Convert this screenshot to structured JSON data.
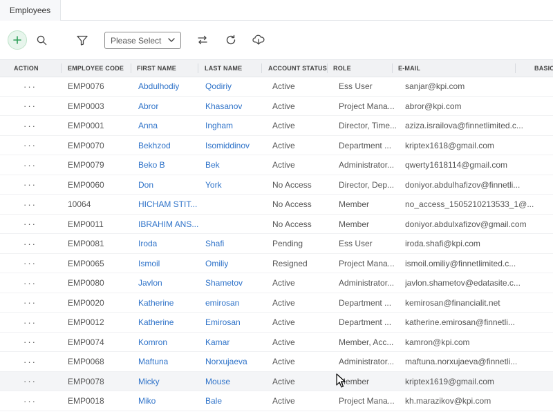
{
  "tab": {
    "label": "Employees"
  },
  "toolbar": {
    "select_placeholder": "Please Select"
  },
  "columns": [
    "ACTION",
    "EMPLOYEE CODE",
    "FIRST NAME",
    "LAST NAME",
    "ACCOUNT STATUS",
    "ROLE",
    "E-MAIL",
    "BASIC"
  ],
  "action_label": "···",
  "rows": [
    {
      "code": "EMP0076",
      "first": "Abdulhodiy",
      "last": "Qodiriy",
      "status": "Active",
      "role": "Ess User",
      "email": "sanjar@kpi.com"
    },
    {
      "code": "EMP0003",
      "first": "Abror",
      "last": "Khasanov",
      "status": "Active",
      "role": "Project Mana...",
      "email": "abror@kpi.com"
    },
    {
      "code": "EMP0001",
      "first": "Anna",
      "last": "Ingham",
      "status": "Active",
      "role": "Director, Time...",
      "email": "aziza.israilova@finnetlimited.c..."
    },
    {
      "code": "EMP0070",
      "first": "Bekhzod",
      "last": "Isomiddinov",
      "status": "Active",
      "role": "Department ...",
      "email": "kriptex1618@gmail.com"
    },
    {
      "code": "EMP0079",
      "first": "Beko B",
      "last": "Bek",
      "status": "Active",
      "role": "Administrator...",
      "email": "qwerty1618114@gmail.com"
    },
    {
      "code": "EMP0060",
      "first": "Don",
      "last": "York",
      "status": "No Access",
      "role": "Director, Dep...",
      "email": "doniyor.abdulhafizov@finnetli..."
    },
    {
      "code": "10064",
      "first": "HICHAM STIT...",
      "last": "",
      "status": "No Access",
      "role": "Member",
      "email": "no_access_1505210213533_1@..."
    },
    {
      "code": "EMP0011",
      "first": "IBRAHIM ANS...",
      "last": "",
      "status": "No Access",
      "role": "Member",
      "email": "doniyor.abdulxafizov@gmail.com"
    },
    {
      "code": "EMP0081",
      "first": "Iroda",
      "last": "Shafi",
      "status": "Pending",
      "role": "Ess User",
      "email": "iroda.shafi@kpi.com"
    },
    {
      "code": "EMP0065",
      "first": "Ismoil",
      "last": "Omiliy",
      "status": "Resigned",
      "role": "Project Mana...",
      "email": "ismoil.omiliy@finnetlimited.c..."
    },
    {
      "code": "EMP0080",
      "first": "Javlon",
      "last": "Shametov",
      "status": "Active",
      "role": "Administrator...",
      "email": "javlon.shametov@edatasite.c..."
    },
    {
      "code": "EMP0020",
      "first": "Katherine",
      "last": "emirosan",
      "status": "Active",
      "role": "Department ...",
      "email": "kemirosan@financialit.net"
    },
    {
      "code": "EMP0012",
      "first": "Katherine",
      "last": "Emirosan",
      "status": "Active",
      "role": "Department ...",
      "email": "katherine.emirosan@finnetli..."
    },
    {
      "code": "EMP0074",
      "first": "Komron",
      "last": "Kamar",
      "status": "Active",
      "role": "Member, Acc...",
      "email": "kamron@kpi.com"
    },
    {
      "code": "EMP0068",
      "first": "Maftuna",
      "last": "Norxujaeva",
      "status": "Active",
      "role": "Administrator...",
      "email": "maftuna.norxujaeva@finnetli..."
    },
    {
      "code": "EMP0078",
      "first": "Micky",
      "last": "Mouse",
      "status": "Active",
      "role": "Member",
      "email": "kriptex1619@gmail.com"
    },
    {
      "code": "EMP0018",
      "first": "Miko",
      "last": "Bale",
      "status": "Active",
      "role": "Project Mana...",
      "email": "kh.marazikov@kpi.com"
    }
  ]
}
